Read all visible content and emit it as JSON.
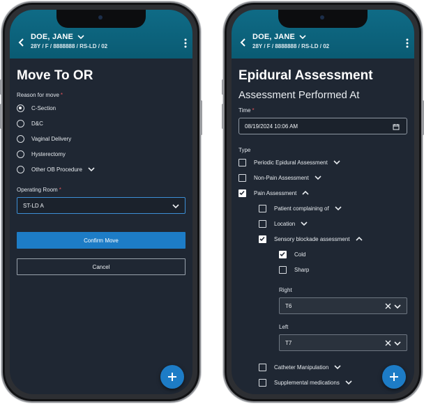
{
  "patient": {
    "name": "DOE, JANE",
    "details": "28Y / F / 8888888 / RS-LD / 02"
  },
  "move_to_or": {
    "title": "Move To OR",
    "reason_label": "Reason for move",
    "reasons": [
      {
        "label": "C-Section",
        "selected": true
      },
      {
        "label": "D&C",
        "selected": false
      },
      {
        "label": "Vaginal Delivery",
        "selected": false
      },
      {
        "label": "Hysterectomy",
        "selected": false
      },
      {
        "label": "Other OB Procedure",
        "selected": false
      }
    ],
    "operating_room_label": "Operating Room",
    "operating_room_value": "ST-LD A",
    "confirm_label": "Confirm Move",
    "cancel_label": "Cancel"
  },
  "epidural": {
    "title": "Epidural Assessment",
    "subtitle": "Assessment Performed At",
    "time_label": "Time",
    "time_value": "08/19/2024 10:06 AM",
    "type_label": "Type",
    "types": [
      {
        "label": "Periodic Epidural Assessment",
        "checked": false
      },
      {
        "label": "Non-Pain Assessment",
        "checked": false
      },
      {
        "label": "Pain Assessment",
        "checked": true
      }
    ],
    "pain_items": [
      {
        "label": "Patient complaining of",
        "checked": false
      },
      {
        "label": "Location",
        "checked": false
      },
      {
        "label": "Sensory blockade assessment",
        "checked": true
      }
    ],
    "sensory_items": [
      {
        "label": "Cold",
        "checked": true
      },
      {
        "label": "Sharp",
        "checked": false
      }
    ],
    "right_label": "Right",
    "right_value": "T6",
    "left_label": "Left",
    "left_value": "T7",
    "more_items": [
      {
        "label": "Catheter Manipulation",
        "checked": false
      },
      {
        "label": "Supplemental medications",
        "checked": false
      }
    ]
  },
  "colors": {
    "header": "#0f6b86",
    "background": "#1f2733",
    "accent": "#1d7cc6",
    "required": "#e0525a"
  },
  "icons": {
    "back": "chevron-left-icon",
    "menu": "kebab-menu-icon",
    "fab": "plus-icon",
    "calendar": "calendar-icon"
  }
}
